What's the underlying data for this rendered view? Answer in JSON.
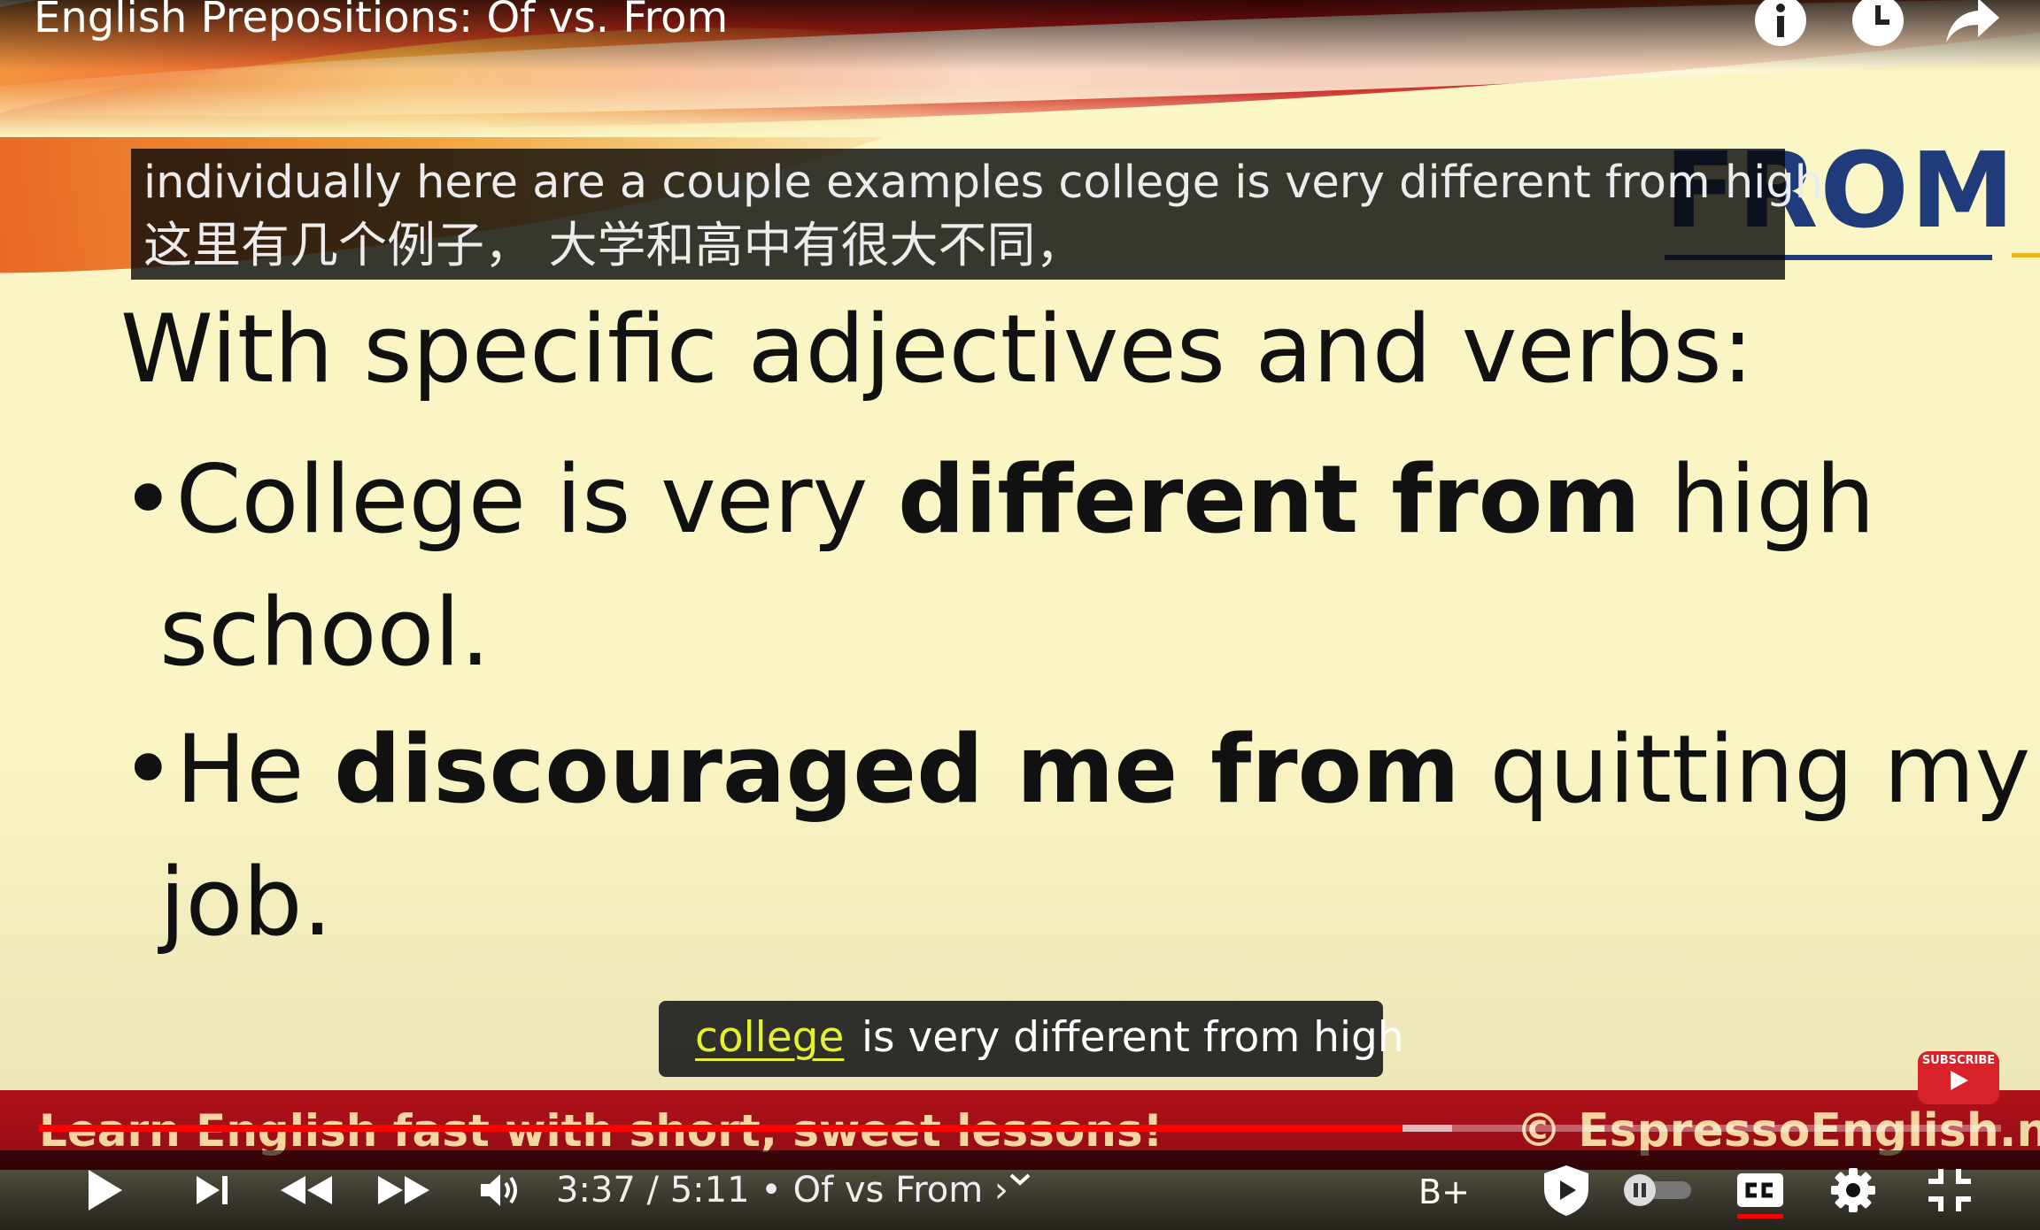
{
  "video": {
    "title": "English Prepositions: Of vs. From"
  },
  "slide": {
    "corner_word": "FROM",
    "heading": "With specific adjectives and verbs:",
    "bullets": [
      {
        "pre": "•College is very ",
        "bold": "different from",
        "post": " high",
        "line2": "school."
      },
      {
        "pre": "•He ",
        "bold": "discouraged me from",
        "post": " quitting my",
        "line2": "job."
      }
    ],
    "band_left": "Learn English fast with short, sweet lessons!",
    "band_right": "© EspressoEnglish.net"
  },
  "captions": {
    "top_english": "individually here are a couple examples college is very different from high",
    "top_chinese": "这里有几个例子， 大学和高中有很大不同，",
    "bottom_highlight": "college",
    "bottom_rest": "is very different from high"
  },
  "subscribe": {
    "label": "SUBSCRIBE"
  },
  "player": {
    "time_current": "3:37",
    "time_separator": " / ",
    "time_total": "5:11",
    "chapter": " • Of vs From ›",
    "quality_badge": "B+",
    "progress_fraction": 0.695,
    "buffer_fraction": 0.72,
    "colors": {
      "progress": "#ff0000",
      "caption_highlight": "#e6f02c"
    },
    "icons": [
      "play-icon",
      "next-icon",
      "rewind-icon",
      "fast-forward-icon",
      "volume-icon",
      "chevron-down-icon",
      "shield-play-icon",
      "autoplay-toggle-icon",
      "captions-icon",
      "settings-gear-icon",
      "exit-fullscreen-icon",
      "info-icon",
      "watch-later-clock-icon",
      "share-arrow-icon"
    ]
  }
}
